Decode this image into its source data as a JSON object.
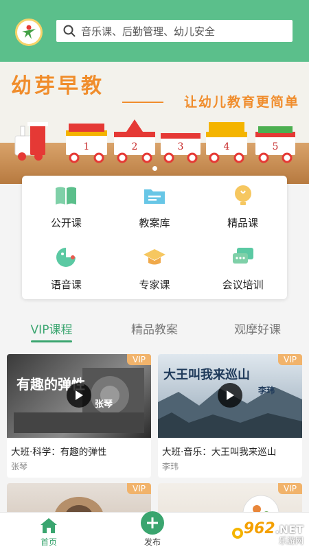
{
  "header": {
    "search_placeholder": "音乐课、后勤管理、幼儿安全"
  },
  "banner": {
    "title": "幼芽早教",
    "subtitle": "让幼儿教育更简单",
    "train_numbers": [
      "1",
      "2",
      "3",
      "4",
      "5"
    ],
    "active_slide": 1,
    "slide_count": 1
  },
  "categories": [
    {
      "label": "公开课",
      "icon": "book-icon"
    },
    {
      "label": "教案库",
      "icon": "folder-icon"
    },
    {
      "label": "精品课",
      "icon": "lightbulb-icon"
    },
    {
      "label": "语音课",
      "icon": "voice-icon"
    },
    {
      "label": "专家课",
      "icon": "graduation-cap-icon"
    },
    {
      "label": "会议培训",
      "icon": "chat-icon"
    }
  ],
  "tabs": [
    {
      "label": "VIP课程",
      "active": true
    },
    {
      "label": "精品教案",
      "active": false
    },
    {
      "label": "观摩好课",
      "active": false
    }
  ],
  "courses": [
    {
      "title": "大班·科学：有趣的弹性",
      "author": "张琴",
      "badge": "VIP",
      "thumb_title": "有趣的弹性",
      "thumb_sub": "张琴"
    },
    {
      "title": "大班·音乐：大王叫我来巡山",
      "author": "李玮",
      "badge": "VIP",
      "thumb_title": "大王叫我来巡山",
      "thumb_sub": "李玮"
    },
    {
      "badge": "VIP"
    },
    {
      "badge": "VIP"
    }
  ],
  "bottom_nav": [
    {
      "label": "首页",
      "active": true
    },
    {
      "label": "发布",
      "active": false
    }
  ],
  "watermark": {
    "brand": "962",
    "suffix": ".NET",
    "sub": "乐游网"
  },
  "colors": {
    "primary": "#5bbf8b",
    "accent": "#3aa56f",
    "vip": "#f1b36b",
    "banner_text": "#f08d2c"
  }
}
